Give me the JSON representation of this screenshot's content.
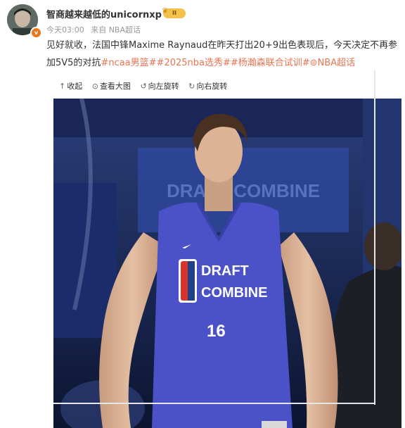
{
  "post": {
    "username": "智商越来越低的unicornxp",
    "vip_badge": "II",
    "timestamp": "今天03:00",
    "source": "来自 NBA超话",
    "text_prefix": "见好就收，法国中锋Maxime Raynaud在昨天打出20+9出色表现后，今天决定不再参加5V5的对抗",
    "hashtags": [
      "#ncaa男篮#",
      "#2025nba选秀#",
      "#杨瀚森联合试训#",
      "NBA超话"
    ],
    "tag_color": "#eb7350"
  },
  "image_toolbar": {
    "collapse": "收起",
    "view_large": "查看大图",
    "rotate_left": "向左旋转",
    "rotate_right": "向右旋转"
  },
  "photo": {
    "jersey_line1": "DRAFT",
    "jersey_line2": "COMBINE",
    "jersey_number": "16",
    "background_sign": "DRAFT COMBINE",
    "jersey_color": "#4b52c8"
  }
}
